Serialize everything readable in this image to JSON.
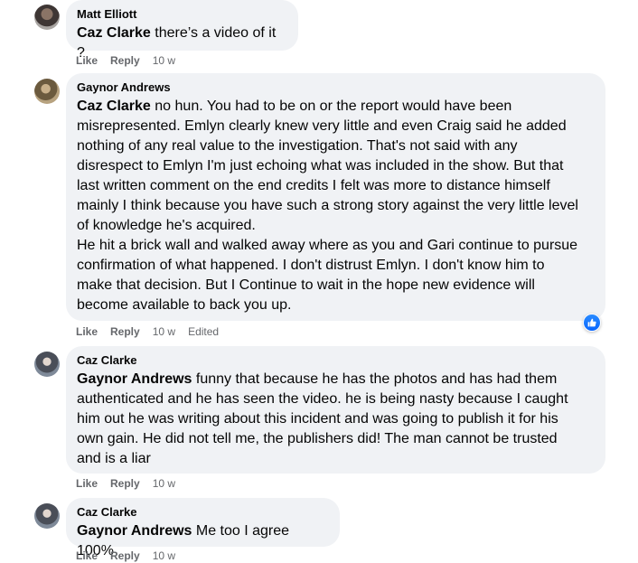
{
  "comments": [
    {
      "author": "Matt Elliott",
      "mention": "Caz Clarke",
      "text": " there’s a video of it ?",
      "actions": {
        "like": "Like",
        "reply": "Reply",
        "time": "10 w"
      }
    },
    {
      "author": "Gaynor Andrews",
      "mention": "Caz Clarke",
      "text": " no hun. You had to be on or the report would have been\nmisrepresented. Emlyn clearly knew very little and even Craig said he added\nnothing of any real value to the investigation. That's not said with any\ndisrespect to Emlyn I'm just echoing what was included in the show. But that\nlast written comment on the end credits I felt was more to distance himself\nmainly I think because you have such a strong story against the very little level\nof knowledge he's acquired.\nHe hit a brick wall and walked away where as you and Gari continue to pursue\nconfirmation of what happened. I don't distrust Emlyn. I don't know him to\nmake that decision. But I Continue to wait in the hope new evidence will\nbecome available to back you up.",
      "actions": {
        "like": "Like",
        "reply": "Reply",
        "time": "10 w",
        "edited": "Edited"
      },
      "reaction": "like-icon"
    },
    {
      "author": "Caz Clarke",
      "mention": "Gaynor Andrews",
      "text": " funny that because he has the photos and has had them\nauthenticated and he has seen the video. he is being nasty because I caught\nhim out he was writing about this incident and was going to publish it for his\nown gain. He did not tell me, the publishers did! The man cannot be trusted\nand is a liar",
      "actions": {
        "like": "Like",
        "reply": "Reply",
        "time": "10 w"
      }
    },
    {
      "author": "Caz Clarke",
      "mention": "Gaynor Andrews",
      "text": " Me too I agree 100%",
      "actions": {
        "like": "Like",
        "reply": "Reply",
        "time": "10 w"
      }
    }
  ],
  "colors": {
    "bubble": "#f0f2f5",
    "meta_text": "#65676b",
    "like_blue": "#0866ff"
  }
}
